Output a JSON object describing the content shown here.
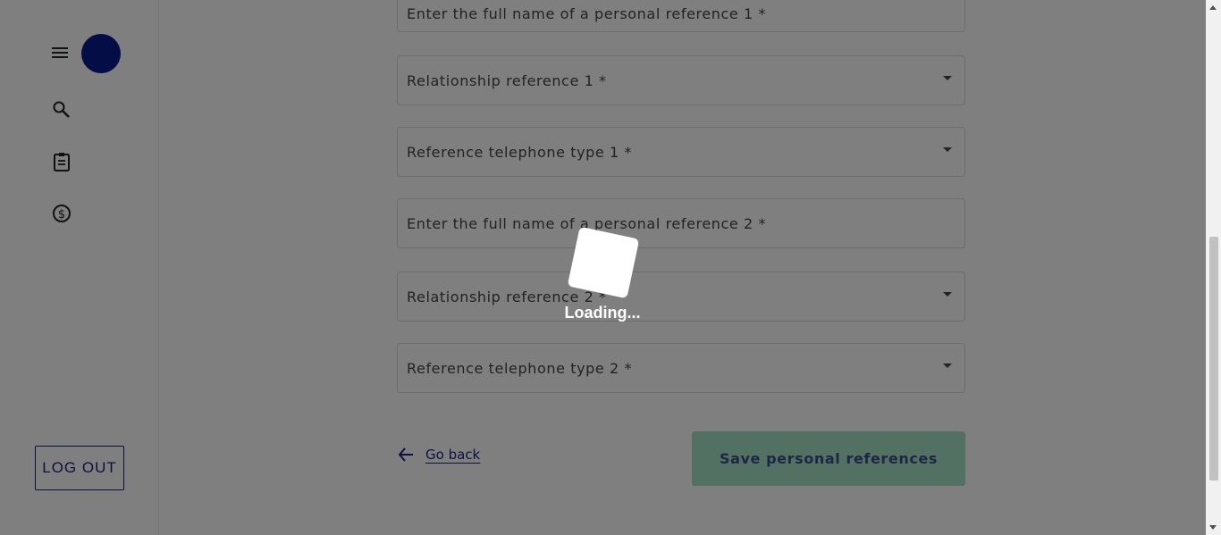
{
  "sidebar": {
    "icons": [
      "menu-icon",
      "avatar",
      "search-icon",
      "clipboard-icon",
      "dollar-icon"
    ],
    "logout_label": "LOG OUT"
  },
  "form": {
    "fields": [
      {
        "placeholder": "Enter the full name of a personal reference 1 *",
        "type": "text"
      },
      {
        "placeholder": "Relationship reference 1 *",
        "type": "select"
      },
      {
        "placeholder": "Reference telephone type 1 *",
        "type": "select"
      },
      {
        "placeholder": "Enter the full name of a personal reference 2 *",
        "type": "text"
      },
      {
        "placeholder": "Relationship reference 2 *",
        "type": "select"
      },
      {
        "placeholder": "Reference telephone type 2 *",
        "type": "select"
      }
    ],
    "go_back_label": "Go back",
    "save_label": "Save personal references"
  },
  "overlay": {
    "loading_text": "Loading..."
  },
  "colors": {
    "primary": "#1a237e",
    "avatar": "#0b1a8c",
    "save_button": "#a6e3c4",
    "overlay": "rgba(0,0,0,0.5)"
  }
}
